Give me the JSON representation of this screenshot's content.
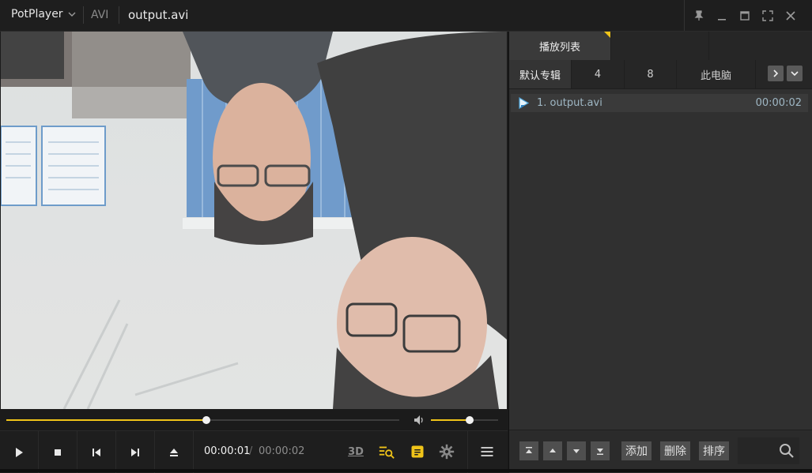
{
  "titlebar": {
    "app_name": "PotPlayer",
    "format": "AVI",
    "file_title": "output.avi"
  },
  "playback": {
    "progress": 0.51,
    "volume": 0.58,
    "time_current": "00:00:01",
    "time_separator": "/",
    "time_total": "00:00:02",
    "label_3d": "3D"
  },
  "colors": {
    "accent": "#f0c419",
    "panel": "#303030",
    "title_bar": "#1e1e1e"
  },
  "playlist": {
    "main_tab": "播放列表",
    "subtabs": [
      "默认专辑",
      "4",
      "8",
      "此电脑"
    ],
    "items": [
      {
        "name": "1. output.avi",
        "duration": "00:00:02"
      }
    ],
    "buttons": {
      "add": "添加",
      "delete": "删除",
      "sort": "排序"
    }
  },
  "icons": [
    "chevron-down-icon",
    "pin-icon",
    "minimize-icon",
    "maximize-icon",
    "fullscreen-icon",
    "close-icon",
    "play-icon",
    "stop-icon",
    "previous-icon",
    "next-icon",
    "eject-icon",
    "volume-icon",
    "3d-icon",
    "playlist-search-icon",
    "subtitle-icon",
    "gear-icon",
    "menu-icon",
    "chevron-right-icon",
    "move-top-icon",
    "move-up-icon",
    "move-down-icon",
    "move-bottom-icon",
    "search-icon"
  ]
}
